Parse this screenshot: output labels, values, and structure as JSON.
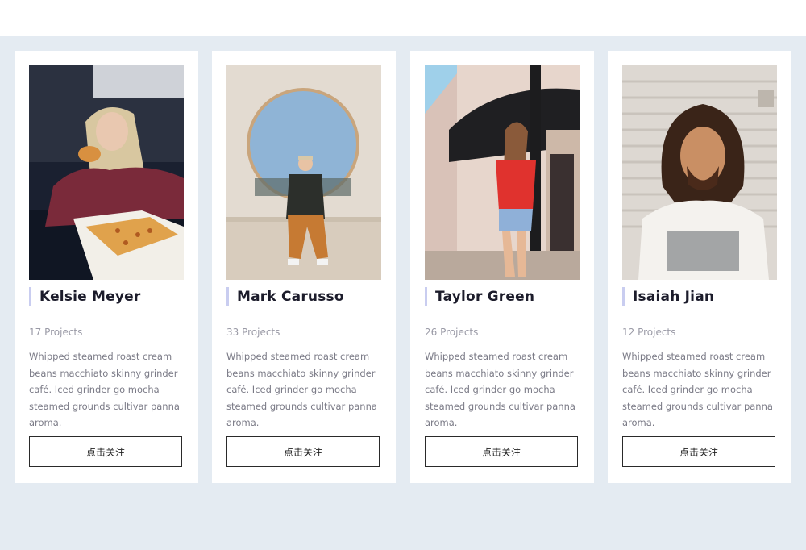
{
  "cards": [
    {
      "name": "Kelsie Meyer",
      "projects": "17 Projects",
      "description": "Whipped steamed roast cream beans macchiato skinny grinder café. Iced grinder go mocha steamed grounds cultivar panna aroma.",
      "button_label": "点击关注",
      "photo": "woman-eating-pizza-photo"
    },
    {
      "name": "Mark Carusso",
      "projects": "33 Projects",
      "description": "Whipped steamed roast cream beans macchiato skinny grinder café. Iced grinder go mocha steamed grounds cultivar panna aroma.",
      "button_label": "点击关注",
      "photo": "man-sitting-on-wall-photo"
    },
    {
      "name": "Taylor Green",
      "projects": "26 Projects",
      "description": "Whipped steamed roast cream beans macchiato skinny grinder café. Iced grinder go mocha steamed grounds cultivar panna aroma.",
      "button_label": "点击关注",
      "photo": "woman-on-street-photo"
    },
    {
      "name": "Isaiah Jian",
      "projects": "12 Projects",
      "description": "Whipped steamed roast cream beans macchiato skinny grinder café. Iced grinder go mocha steamed grounds cultivar panna aroma.",
      "button_label": "点击关注",
      "photo": "man-with-dreadlocks-photo"
    }
  ],
  "colors": {
    "section_background": "#e4ebf2",
    "card_background": "#ffffff",
    "name_accent_bar": "#c9cdf0",
    "name_text": "#1c1c2b",
    "muted_text": "#9a9aa6"
  }
}
